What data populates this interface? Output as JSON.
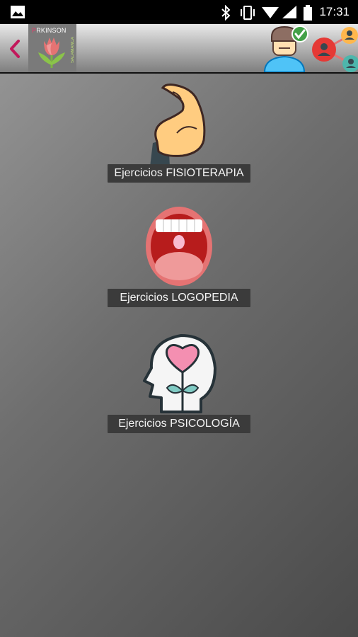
{
  "status_bar": {
    "time": "17:31",
    "icons": [
      "image-icon",
      "bluetooth-icon",
      "vibrate-icon",
      "wifi-icon",
      "signal-icon",
      "battery-icon"
    ]
  },
  "app_bar": {
    "logo": {
      "title_first": "P",
      "title_rest": "RKINSON",
      "subtitle": "SALAMANCA"
    },
    "icons": [
      "back-arrow-icon",
      "user-verified-icon",
      "network-icon"
    ]
  },
  "menu": {
    "items": [
      {
        "icon": "flexed-arm-icon",
        "label": "Ejercicios FISIOTERAPIA"
      },
      {
        "icon": "open-mouth-icon",
        "label": "Ejercicios LOGOPEDIA"
      },
      {
        "icon": "head-heart-icon",
        "label": "Ejercicios PSICOLOGÍA"
      }
    ]
  },
  "colors": {
    "accent": "#c2185b",
    "label_bg": "#3b3b3b"
  }
}
